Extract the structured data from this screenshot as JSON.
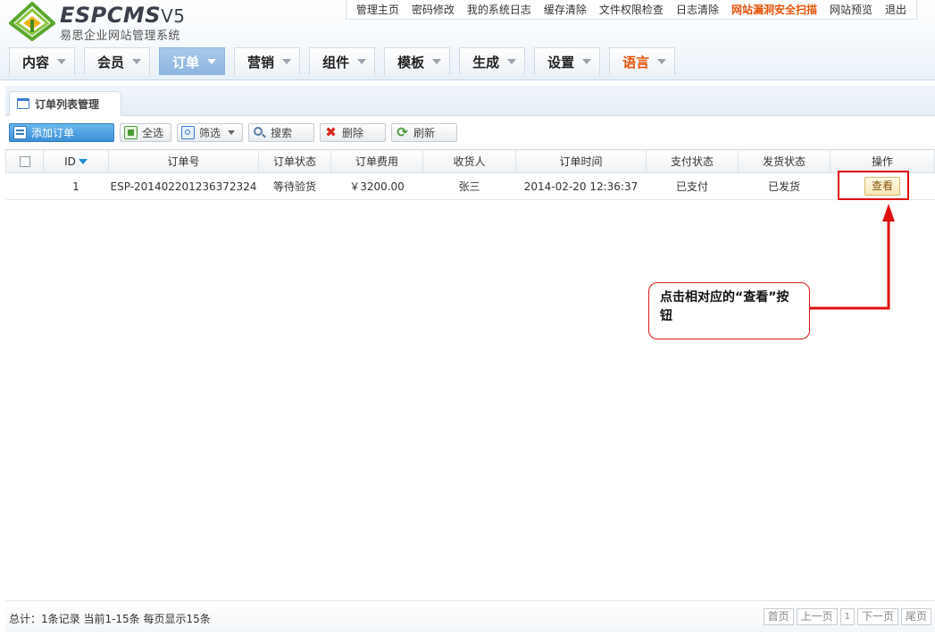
{
  "brand": {
    "name": "ESPCMS",
    "version": "V5",
    "subtitle": "易思企业网站管理系统"
  },
  "topnav": [
    {
      "label": "管理主页",
      "hot": false
    },
    {
      "label": "密码修改",
      "hot": false
    },
    {
      "label": "我的系统日志",
      "hot": false
    },
    {
      "label": "缓存清除",
      "hot": false
    },
    {
      "label": "文件权限检查",
      "hot": false
    },
    {
      "label": "日志清除",
      "hot": false
    },
    {
      "label": "网站漏洞安全扫描",
      "hot": true
    },
    {
      "label": "网站预览",
      "hot": false
    },
    {
      "label": "退出",
      "hot": false
    }
  ],
  "mainnav": [
    {
      "label": "内容",
      "active": false
    },
    {
      "label": "会员",
      "active": false
    },
    {
      "label": "订单",
      "active": true
    },
    {
      "label": "营销",
      "active": false
    },
    {
      "label": "组件",
      "active": false
    },
    {
      "label": "模板",
      "active": false
    },
    {
      "label": "生成",
      "active": false
    },
    {
      "label": "设置",
      "active": false
    },
    {
      "label": "语言",
      "active": false,
      "lang": true
    }
  ],
  "panel": {
    "tab_label": "订单列表管理"
  },
  "toolbar": {
    "add_label": "添加订单",
    "select_all_label": "全选",
    "filter_label": "筛选",
    "search_label": "搜索",
    "delete_label": "删除",
    "refresh_label": "刷新"
  },
  "table": {
    "columns": [
      "ID",
      "订单号",
      "订单状态",
      "订单费用",
      "收货人",
      "订单时间",
      "支付状态",
      "发货状态",
      "操作"
    ],
    "rows": [
      {
        "id": "1",
        "order_no": "ESP-201402201236372324",
        "order_status": "等待验货",
        "fee": "￥3200.00",
        "consignee": "张三",
        "time": "2014-02-20 12:36:37",
        "pay_status": "已支付",
        "ship_status": "已发货",
        "action_label": "查看"
      }
    ]
  },
  "annotation": {
    "text": "点击相对应的“查看”按钮",
    "color": "#e01010"
  },
  "footer": {
    "info": "总计：1条记录 当前1-15条 每页显示15条",
    "pager": [
      "首页",
      "上一页",
      "1",
      "下一页",
      "尾页"
    ]
  }
}
